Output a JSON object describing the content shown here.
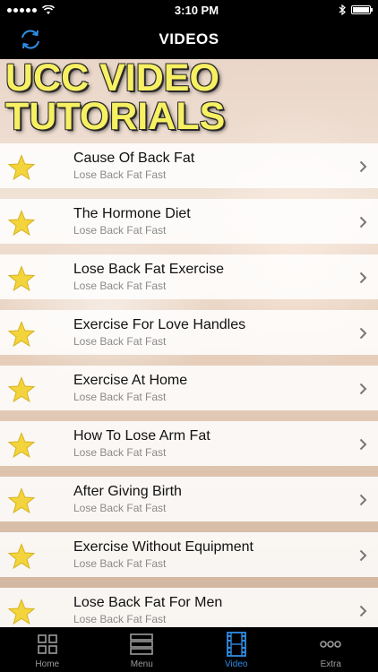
{
  "status": {
    "time": "3:10 PM"
  },
  "nav": {
    "title": "VIDEOS"
  },
  "headline": "UCC VIDEO\nTUTORIALS",
  "items": [
    {
      "title": "Cause Of Back Fat",
      "subtitle": "Lose Back Fat Fast"
    },
    {
      "title": "The Hormone Diet",
      "subtitle": "Lose Back Fat Fast"
    },
    {
      "title": "Lose Back Fat Exercise",
      "subtitle": "Lose Back Fat Fast"
    },
    {
      "title": "Exercise For Love Handles",
      "subtitle": "Lose Back Fat Fast"
    },
    {
      "title": "Exercise At Home",
      "subtitle": "Lose Back Fat Fast"
    },
    {
      "title": "How To Lose Arm Fat",
      "subtitle": "Lose Back Fat Fast"
    },
    {
      "title": "After Giving Birth",
      "subtitle": "Lose Back Fat Fast"
    },
    {
      "title": "Exercise Without Equipment",
      "subtitle": "Lose Back Fat Fast"
    },
    {
      "title": "Lose Back Fat For Men",
      "subtitle": "Lose Back Fat Fast"
    }
  ],
  "tabs": [
    {
      "label": "Home",
      "icon": "grid-icon",
      "active": false
    },
    {
      "label": "Menu",
      "icon": "list-icon",
      "active": false
    },
    {
      "label": "Video",
      "icon": "film-icon",
      "active": true
    },
    {
      "label": "Extra",
      "icon": "more-icon",
      "active": false
    }
  ],
  "colors": {
    "accent": "#2f8de4",
    "headline": "#f7f062",
    "star": "#f4d43c"
  }
}
